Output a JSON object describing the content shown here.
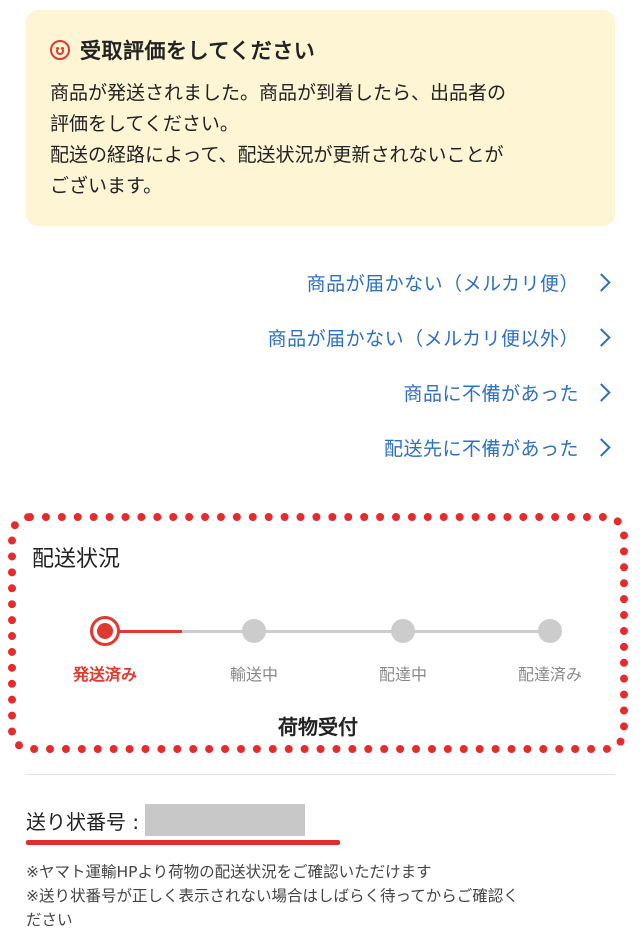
{
  "notice": {
    "title": "受取評価をしてください",
    "line1": "商品が発送されました。商品が到着したら、出品者の",
    "line2": "評価をしてください。",
    "line3": "配送の経路によって、配送状況が更新されないことが",
    "line4": "ございます。"
  },
  "links": [
    {
      "label": "商品が届かない（メルカリ便）"
    },
    {
      "label": "商品が届かない（メルカリ便以外）"
    },
    {
      "label": "商品に不備があった"
    },
    {
      "label": "配送先に不備があった"
    }
  ],
  "shipping_status": {
    "title": "配送状況",
    "steps": [
      "発送済み",
      "輸送中",
      "配達中",
      "配達済み"
    ],
    "current_step_index": 0,
    "current_status": "荷物受付"
  },
  "tracking": {
    "label": "送り状番号 :",
    "value": ""
  },
  "notes": {
    "line1": "※ヤマト運輸HPより荷物の配送状況をご確認いただけます",
    "line2": "※送り状番号が正しく表示されない場合はしばらく待ってからご確認く",
    "line3": "ださい"
  },
  "colors": {
    "accent_red": "#e0392f",
    "link_blue": "#2d6fc0",
    "notice_bg": "#fdf5d4",
    "inactive_gray": "#cccccc"
  }
}
